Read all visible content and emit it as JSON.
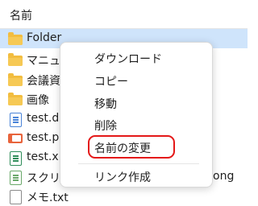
{
  "header": {
    "name_col": "名前"
  },
  "files": [
    {
      "name": "Folder",
      "icon": "folder-icon"
    },
    {
      "name": "マニュア",
      "icon": "folder-icon"
    },
    {
      "name": "会議資",
      "icon": "folder-icon"
    },
    {
      "name": "画像",
      "icon": "folder-icon"
    },
    {
      "name": "test.d",
      "icon": "word-document-icon"
    },
    {
      "name": "test.p",
      "icon": "powerpoint-icon"
    },
    {
      "name": "test.x",
      "icon": "excel-icon"
    },
    {
      "name": "スクリ",
      "icon": "script-icon"
    },
    {
      "name": "メモ.txt",
      "icon": "text-file-icon"
    }
  ],
  "row_tail": "ong",
  "context_menu": {
    "items": [
      {
        "label": "ダウンロード"
      },
      {
        "label": "コピー"
      },
      {
        "label": "移動"
      },
      {
        "label": "削除"
      },
      {
        "label": "名前の変更"
      },
      {
        "label": "リンク作成"
      }
    ],
    "highlight_color": "#e41818"
  },
  "colors": {
    "selection": "#cfe4fb",
    "folder": "#f2bd3f"
  }
}
